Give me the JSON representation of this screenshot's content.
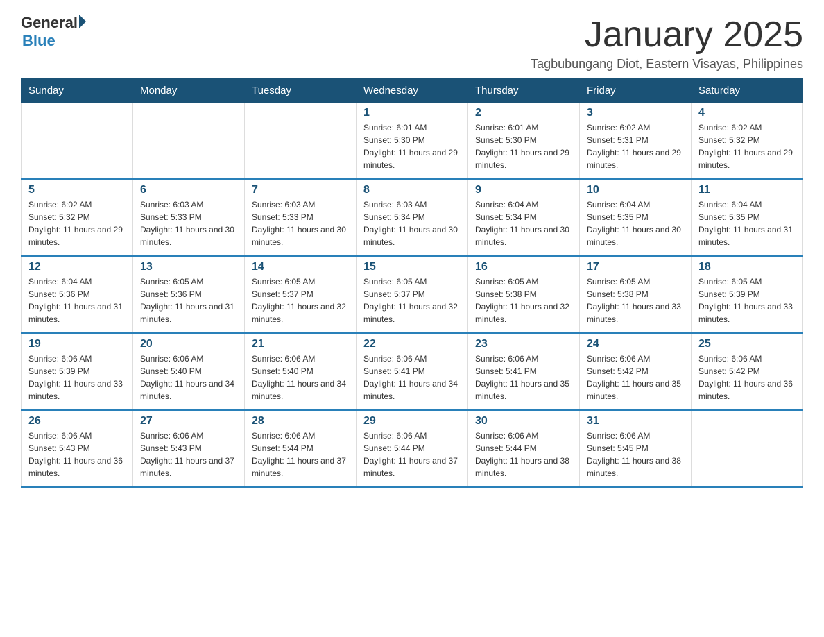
{
  "logo": {
    "general": "General",
    "blue": "Blue"
  },
  "header": {
    "title": "January 2025",
    "subtitle": "Tagbubungang Diot, Eastern Visayas, Philippines"
  },
  "days_of_week": [
    "Sunday",
    "Monday",
    "Tuesday",
    "Wednesday",
    "Thursday",
    "Friday",
    "Saturday"
  ],
  "weeks": [
    [
      {
        "day": "",
        "info": ""
      },
      {
        "day": "",
        "info": ""
      },
      {
        "day": "",
        "info": ""
      },
      {
        "day": "1",
        "info": "Sunrise: 6:01 AM\nSunset: 5:30 PM\nDaylight: 11 hours and 29 minutes."
      },
      {
        "day": "2",
        "info": "Sunrise: 6:01 AM\nSunset: 5:30 PM\nDaylight: 11 hours and 29 minutes."
      },
      {
        "day": "3",
        "info": "Sunrise: 6:02 AM\nSunset: 5:31 PM\nDaylight: 11 hours and 29 minutes."
      },
      {
        "day": "4",
        "info": "Sunrise: 6:02 AM\nSunset: 5:32 PM\nDaylight: 11 hours and 29 minutes."
      }
    ],
    [
      {
        "day": "5",
        "info": "Sunrise: 6:02 AM\nSunset: 5:32 PM\nDaylight: 11 hours and 29 minutes."
      },
      {
        "day": "6",
        "info": "Sunrise: 6:03 AM\nSunset: 5:33 PM\nDaylight: 11 hours and 30 minutes."
      },
      {
        "day": "7",
        "info": "Sunrise: 6:03 AM\nSunset: 5:33 PM\nDaylight: 11 hours and 30 minutes."
      },
      {
        "day": "8",
        "info": "Sunrise: 6:03 AM\nSunset: 5:34 PM\nDaylight: 11 hours and 30 minutes."
      },
      {
        "day": "9",
        "info": "Sunrise: 6:04 AM\nSunset: 5:34 PM\nDaylight: 11 hours and 30 minutes."
      },
      {
        "day": "10",
        "info": "Sunrise: 6:04 AM\nSunset: 5:35 PM\nDaylight: 11 hours and 30 minutes."
      },
      {
        "day": "11",
        "info": "Sunrise: 6:04 AM\nSunset: 5:35 PM\nDaylight: 11 hours and 31 minutes."
      }
    ],
    [
      {
        "day": "12",
        "info": "Sunrise: 6:04 AM\nSunset: 5:36 PM\nDaylight: 11 hours and 31 minutes."
      },
      {
        "day": "13",
        "info": "Sunrise: 6:05 AM\nSunset: 5:36 PM\nDaylight: 11 hours and 31 minutes."
      },
      {
        "day": "14",
        "info": "Sunrise: 6:05 AM\nSunset: 5:37 PM\nDaylight: 11 hours and 32 minutes."
      },
      {
        "day": "15",
        "info": "Sunrise: 6:05 AM\nSunset: 5:37 PM\nDaylight: 11 hours and 32 minutes."
      },
      {
        "day": "16",
        "info": "Sunrise: 6:05 AM\nSunset: 5:38 PM\nDaylight: 11 hours and 32 minutes."
      },
      {
        "day": "17",
        "info": "Sunrise: 6:05 AM\nSunset: 5:38 PM\nDaylight: 11 hours and 33 minutes."
      },
      {
        "day": "18",
        "info": "Sunrise: 6:05 AM\nSunset: 5:39 PM\nDaylight: 11 hours and 33 minutes."
      }
    ],
    [
      {
        "day": "19",
        "info": "Sunrise: 6:06 AM\nSunset: 5:39 PM\nDaylight: 11 hours and 33 minutes."
      },
      {
        "day": "20",
        "info": "Sunrise: 6:06 AM\nSunset: 5:40 PM\nDaylight: 11 hours and 34 minutes."
      },
      {
        "day": "21",
        "info": "Sunrise: 6:06 AM\nSunset: 5:40 PM\nDaylight: 11 hours and 34 minutes."
      },
      {
        "day": "22",
        "info": "Sunrise: 6:06 AM\nSunset: 5:41 PM\nDaylight: 11 hours and 34 minutes."
      },
      {
        "day": "23",
        "info": "Sunrise: 6:06 AM\nSunset: 5:41 PM\nDaylight: 11 hours and 35 minutes."
      },
      {
        "day": "24",
        "info": "Sunrise: 6:06 AM\nSunset: 5:42 PM\nDaylight: 11 hours and 35 minutes."
      },
      {
        "day": "25",
        "info": "Sunrise: 6:06 AM\nSunset: 5:42 PM\nDaylight: 11 hours and 36 minutes."
      }
    ],
    [
      {
        "day": "26",
        "info": "Sunrise: 6:06 AM\nSunset: 5:43 PM\nDaylight: 11 hours and 36 minutes."
      },
      {
        "day": "27",
        "info": "Sunrise: 6:06 AM\nSunset: 5:43 PM\nDaylight: 11 hours and 37 minutes."
      },
      {
        "day": "28",
        "info": "Sunrise: 6:06 AM\nSunset: 5:44 PM\nDaylight: 11 hours and 37 minutes."
      },
      {
        "day": "29",
        "info": "Sunrise: 6:06 AM\nSunset: 5:44 PM\nDaylight: 11 hours and 37 minutes."
      },
      {
        "day": "30",
        "info": "Sunrise: 6:06 AM\nSunset: 5:44 PM\nDaylight: 11 hours and 38 minutes."
      },
      {
        "day": "31",
        "info": "Sunrise: 6:06 AM\nSunset: 5:45 PM\nDaylight: 11 hours and 38 minutes."
      },
      {
        "day": "",
        "info": ""
      }
    ]
  ]
}
